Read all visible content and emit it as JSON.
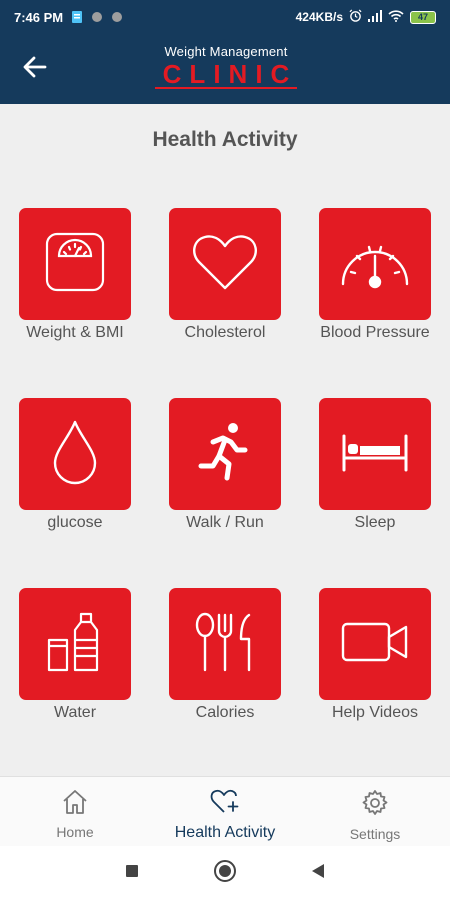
{
  "status_bar": {
    "time": "7:46 PM",
    "speed": "424KB/s",
    "battery": "47"
  },
  "header": {
    "logo_top": "Weight Management",
    "logo_main": "CLINIC",
    "back_icon": "back-arrow-icon"
  },
  "page": {
    "title": "Health Activity"
  },
  "tiles": [
    {
      "label": "Weight & BMI",
      "icon": "weighing-scale-icon"
    },
    {
      "label": "Cholesterol",
      "icon": "heart-icon"
    },
    {
      "label": "Blood Pressure",
      "icon": "gauge-icon"
    },
    {
      "label": "glucose",
      "icon": "drop-icon"
    },
    {
      "label": "Walk / Run",
      "icon": "running-person-icon"
    },
    {
      "label": "Sleep",
      "icon": "bed-icon"
    },
    {
      "label": "Water",
      "icon": "water-bottle-icon"
    },
    {
      "label": "Calories",
      "icon": "cutlery-icon"
    },
    {
      "label": "Help Videos",
      "icon": "video-camera-icon"
    }
  ],
  "bottom_nav": [
    {
      "label": "Home",
      "icon": "home-icon",
      "active": false
    },
    {
      "label": "Health Activity",
      "icon": "heart-plus-icon",
      "active": true
    },
    {
      "label": "Settings",
      "icon": "gear-icon",
      "active": false
    }
  ],
  "colors": {
    "primary": "#153a5c",
    "accent": "#e31b23",
    "background": "#efefef"
  }
}
